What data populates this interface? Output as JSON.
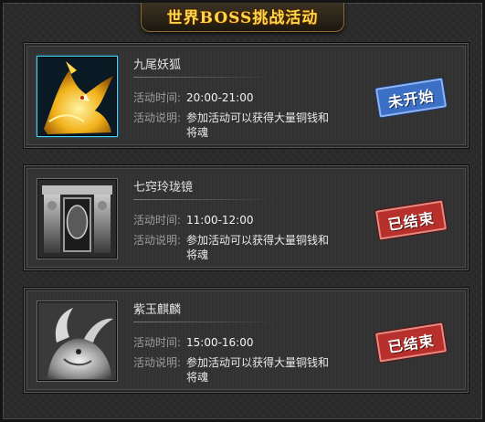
{
  "title": "世界BOSS挑战活动",
  "labels": {
    "time": "活动时间:",
    "desc": "活动说明:"
  },
  "colors": {
    "title": "#ffd54a",
    "stamp_pending": "#3c6fc6",
    "stamp_ended": "#b8302b"
  },
  "bosses": [
    {
      "name": "九尾妖狐",
      "time": "20:00-21:00",
      "desc": "参加活动可以获得大量铜钱和将魂",
      "status": "未开始",
      "status_kind": "pending",
      "icon": "nine-tailed-fox-portrait"
    },
    {
      "name": "七窍玲珑镜",
      "time": "11:00-12:00",
      "desc": "参加活动可以获得大量铜钱和将魂",
      "status": "已结束",
      "status_kind": "ended",
      "icon": "mirror-gate-portrait"
    },
    {
      "name": "紫玉麒麟",
      "time": "15:00-16:00",
      "desc": "参加活动可以获得大量铜钱和将魂",
      "status": "已结束",
      "status_kind": "ended",
      "icon": "qilin-portrait"
    }
  ]
}
